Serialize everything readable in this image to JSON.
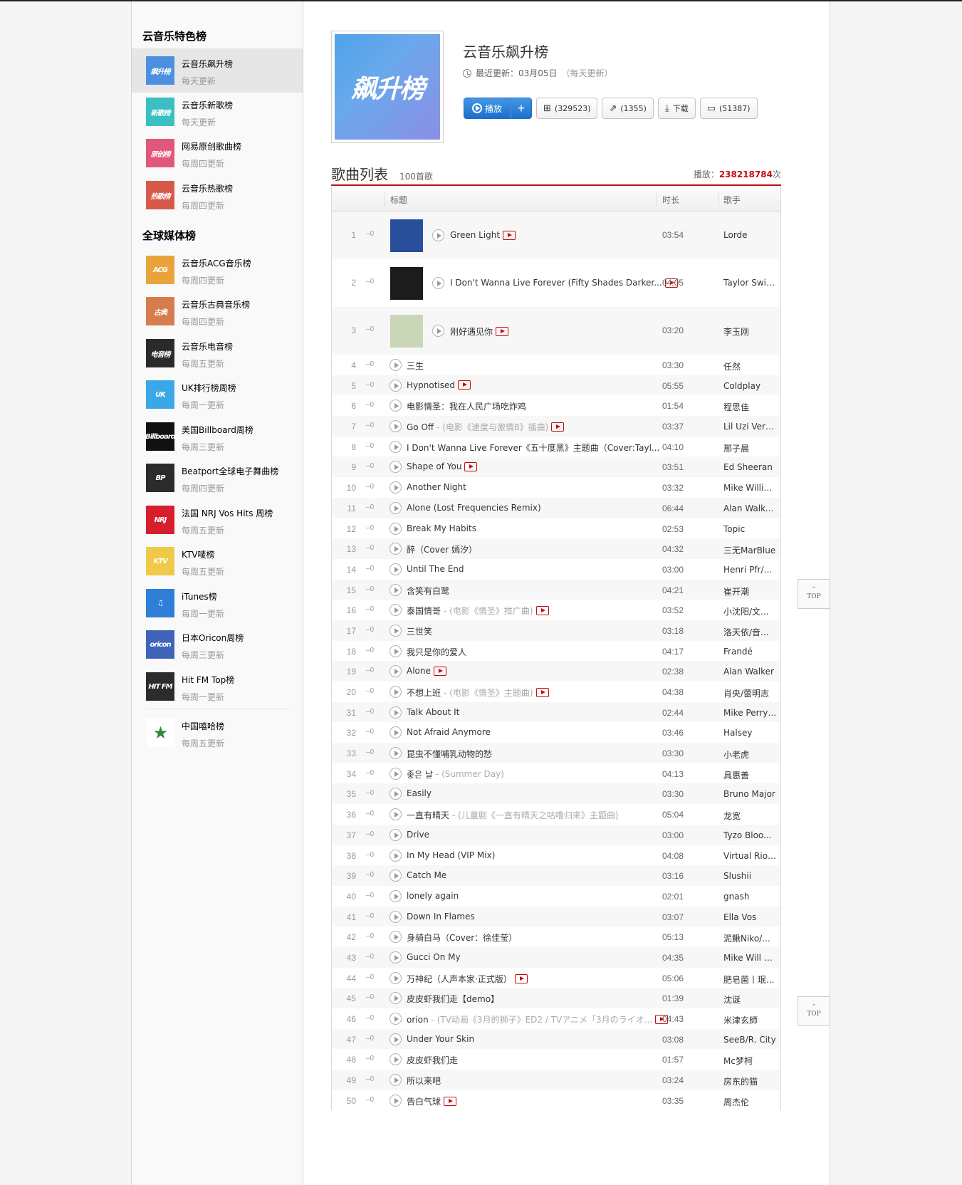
{
  "sidebar": {
    "section1_title": "云音乐特色榜",
    "section2_title": "全球媒体榜",
    "items": [
      {
        "name": "云音乐飙升榜",
        "freq": "每天更新",
        "cover_text": "飙升榜",
        "color": "#4d8fe0"
      },
      {
        "name": "云音乐新歌榜",
        "freq": "每天更新",
        "cover_text": "新歌榜",
        "color": "#3bbfc3"
      },
      {
        "name": "网易原创歌曲榜",
        "freq": "每周四更新",
        "cover_text": "原创榜",
        "color": "#e0577a"
      },
      {
        "name": "云音乐热歌榜",
        "freq": "每周四更新",
        "cover_text": "热歌榜",
        "color": "#d65a4a"
      },
      {
        "name": "云音乐ACG音乐榜",
        "freq": "每周四更新",
        "cover_text": "ACG",
        "color": "#e9a33b"
      },
      {
        "name": "云音乐古典音乐榜",
        "freq": "每周四更新",
        "cover_text": "古典",
        "color": "#d77c4d"
      },
      {
        "name": "云音乐电音榜",
        "freq": "每周五更新",
        "cover_text": "电音榜",
        "color": "#2a2a2a"
      },
      {
        "name": "UK排行榜周榜",
        "freq": "每周一更新",
        "cover_text": "UK",
        "color": "#3aa8e8"
      },
      {
        "name": "美国Billboard周榜",
        "freq": "每周三更新",
        "cover_text": "Billboard",
        "color": "#111111"
      },
      {
        "name": "Beatport全球电子舞曲榜",
        "freq": "每周四更新",
        "cover_text": "BP",
        "color": "#2b2b2b"
      },
      {
        "name": "法国 NRJ Vos Hits 周榜",
        "freq": "每周五更新",
        "cover_text": "NRJ",
        "color": "#d61f2b"
      },
      {
        "name": "KTV唛榜",
        "freq": "每周五更新",
        "cover_text": "KTV",
        "color": "#f0c948"
      },
      {
        "name": "iTunes榜",
        "freq": "每周一更新",
        "cover_text": "♫",
        "color": "#2f7fd8"
      },
      {
        "name": "日本Oricon周榜",
        "freq": "每周三更新",
        "cover_text": "oricon",
        "color": "#3f63b8"
      },
      {
        "name": "Hit FM Top榜",
        "freq": "每周一更新",
        "cover_text": "HIT FM",
        "color": "#2c2c2c"
      },
      {
        "name": "中国嘻哈榜",
        "freq": "每周五更新",
        "cover_text": "★",
        "color": "#ffffff"
      }
    ]
  },
  "header": {
    "cover_text": "飙升榜",
    "title": "云音乐飙升榜",
    "update_label": "最近更新：03月05日",
    "update_note": "（每天更新）",
    "play_label": "播放",
    "add_label": "+",
    "collect_count": "(329523)",
    "share_count": "(1355)",
    "download_label": "下载",
    "comment_count": "(51387)"
  },
  "list": {
    "title": "歌曲列表",
    "count": "100首歌",
    "plays_label": "播放：",
    "plays_value": "238218784",
    "plays_unit": "次",
    "columns": {
      "title": "标题",
      "duration": "时长",
      "artist": "歌手"
    }
  },
  "songs": [
    {
      "rank": "1",
      "trend": "–0",
      "title": "Green Light",
      "sub": "",
      "mv": true,
      "duration": "03:54",
      "artist": "Lorde",
      "thumb": "#2a4f9a"
    },
    {
      "rank": "2",
      "trend": "–0",
      "title": "I Don't Wanna Live Forever (Fifty Shades Darker...",
      "sub": "",
      "mv": true,
      "duration": "04:05",
      "artist": "Taylor Swift...",
      "thumb": "#1c1c1c"
    },
    {
      "rank": "3",
      "trend": "–0",
      "title": "刚好遇见你",
      "sub": "",
      "mv": true,
      "duration": "03:20",
      "artist": "李玉刚",
      "thumb": "#c9d6b8"
    },
    {
      "rank": "4",
      "trend": "–0",
      "title": "三生",
      "sub": "",
      "mv": false,
      "duration": "03:30",
      "artist": "任然"
    },
    {
      "rank": "5",
      "trend": "–0",
      "title": "Hypnotised",
      "sub": "",
      "mv": true,
      "duration": "05:55",
      "artist": "Coldplay"
    },
    {
      "rank": "6",
      "trend": "–0",
      "title": "电影情圣：我在人民广场吃炸鸡",
      "sub": "",
      "mv": false,
      "duration": "01:54",
      "artist": "程思佳"
    },
    {
      "rank": "7",
      "trend": "–0",
      "title": "Go Off",
      "sub": " - (电影《速度与激情8》插曲)",
      "mv": true,
      "duration": "03:37",
      "artist": "Lil Uzi Vert/..."
    },
    {
      "rank": "8",
      "trend": "–0",
      "title": "I Don't Wanna Live Forever《五十度黑》主题曲（Cover:Tayl...",
      "sub": "",
      "mv": false,
      "duration": "04:10",
      "artist": "邢子晨"
    },
    {
      "rank": "9",
      "trend": "–0",
      "title": "Shape of You",
      "sub": "",
      "mv": true,
      "duration": "03:51",
      "artist": "Ed Sheeran"
    },
    {
      "rank": "10",
      "trend": "–0",
      "title": "Another Night",
      "sub": "",
      "mv": false,
      "duration": "03:32",
      "artist": "Mike Willia..."
    },
    {
      "rank": "11",
      "trend": "–0",
      "title": "Alone (Lost Frequencies Remix)",
      "sub": "",
      "mv": false,
      "duration": "06:44",
      "artist": "Alan Walke..."
    },
    {
      "rank": "12",
      "trend": "–0",
      "title": "Break My Habits",
      "sub": "",
      "mv": false,
      "duration": "02:53",
      "artist": "Topic"
    },
    {
      "rank": "13",
      "trend": "–0",
      "title": "醉（Cover 嫣汐）",
      "sub": "",
      "mv": false,
      "duration": "04:32",
      "artist": "三无MarBlue"
    },
    {
      "rank": "14",
      "trend": "–0",
      "title": "Until The End",
      "sub": "",
      "mv": false,
      "duration": "03:00",
      "artist": "Henri Pfr/R..."
    },
    {
      "rank": "15",
      "trend": "–0",
      "title": "含笑有白鹭",
      "sub": "",
      "mv": false,
      "duration": "04:21",
      "artist": "崔开潮"
    },
    {
      "rank": "16",
      "trend": "–0",
      "title": "泰国情哥",
      "sub": " - (电影《情圣》推广曲)",
      "mv": true,
      "duration": "03:52",
      "artist": "小沈阳/文..."
    },
    {
      "rank": "17",
      "trend": "–0",
      "title": "三世笑",
      "sub": "",
      "mv": false,
      "duration": "03:18",
      "artist": "洛天依/音..."
    },
    {
      "rank": "18",
      "trend": "–0",
      "title": "我只是你的爱人",
      "sub": "",
      "mv": false,
      "duration": "04:17",
      "artist": "Frandé"
    },
    {
      "rank": "19",
      "trend": "–0",
      "title": "Alone",
      "sub": "",
      "mv": true,
      "duration": "02:38",
      "artist": "Alan Walker"
    },
    {
      "rank": "20",
      "trend": "–0",
      "title": "不想上班",
      "sub": " - (电影《情圣》主题曲)",
      "mv": true,
      "duration": "04:38",
      "artist": "肖央/蕾明志"
    },
    {
      "rank": "31",
      "trend": "–0",
      "title": "Talk About It",
      "sub": "",
      "mv": false,
      "duration": "02:44",
      "artist": "Mike Perry/..."
    },
    {
      "rank": "32",
      "trend": "–0",
      "title": "Not Afraid Anymore",
      "sub": "",
      "mv": false,
      "duration": "03:46",
      "artist": "Halsey"
    },
    {
      "rank": "33",
      "trend": "–0",
      "title": "昆虫不懂哺乳动物的愁",
      "sub": "",
      "mv": false,
      "duration": "03:30",
      "artist": "小老虎"
    },
    {
      "rank": "34",
      "trend": "–0",
      "title": "좋은 날",
      "sub": " - (Summer Day)",
      "mv": false,
      "duration": "04:13",
      "artist": "具惠善"
    },
    {
      "rank": "35",
      "trend": "–0",
      "title": "Easily",
      "sub": "",
      "mv": false,
      "duration": "03:30",
      "artist": "Bruno Major"
    },
    {
      "rank": "36",
      "trend": "–0",
      "title": "一直有晴天",
      "sub": " - (儿童剧《一直有晴天之咕噜归来》主题曲)",
      "mv": false,
      "duration": "05:04",
      "artist": "龙宽"
    },
    {
      "rank": "37",
      "trend": "–0",
      "title": "Drive",
      "sub": "",
      "mv": false,
      "duration": "03:00",
      "artist": "Tyzo Bloo..."
    },
    {
      "rank": "38",
      "trend": "–0",
      "title": "In My Head (VIP Mix)",
      "sub": "",
      "mv": false,
      "duration": "04:08",
      "artist": "Virtual Riot..."
    },
    {
      "rank": "39",
      "trend": "–0",
      "title": "Catch Me",
      "sub": "",
      "mv": false,
      "duration": "03:16",
      "artist": "Slushii"
    },
    {
      "rank": "40",
      "trend": "–0",
      "title": "lonely again",
      "sub": "",
      "mv": false,
      "duration": "02:01",
      "artist": "gnash"
    },
    {
      "rank": "41",
      "trend": "–0",
      "title": "Down In Flames",
      "sub": "",
      "mv": false,
      "duration": "03:07",
      "artist": "Ella Vos"
    },
    {
      "rank": "42",
      "trend": "–0",
      "title": "身骑白马（Cover：徐佳莹）",
      "sub": "",
      "mv": false,
      "duration": "05:13",
      "artist": "泥鳅Niko/..."
    },
    {
      "rank": "43",
      "trend": "–0",
      "title": "Gucci On My",
      "sub": "",
      "mv": false,
      "duration": "04:35",
      "artist": "Mike Will M..."
    },
    {
      "rank": "44",
      "trend": "–0",
      "title": "万神纪（人声本家·正式版）",
      "sub": "",
      "mv": true,
      "duration": "05:06",
      "artist": "肥皂菌丨珉..."
    },
    {
      "rank": "45",
      "trend": "–0",
      "title": "皮皮虾我们走【demo】",
      "sub": "",
      "mv": false,
      "duration": "01:39",
      "artist": "沈诞"
    },
    {
      "rank": "46",
      "trend": "–0",
      "title": "orion",
      "sub": " - (TV动画《3月的狮子》ED2 / TVアニメ「3月のライオ...",
      "mv": true,
      "duration": "04:43",
      "artist": "米津玄師"
    },
    {
      "rank": "47",
      "trend": "–0",
      "title": "Under Your Skin",
      "sub": "",
      "mv": false,
      "duration": "03:08",
      "artist": "SeeB/R. City"
    },
    {
      "rank": "48",
      "trend": "–0",
      "title": "皮皮虾我们走",
      "sub": "",
      "mv": false,
      "duration": "01:57",
      "artist": "Mc梦柯"
    },
    {
      "rank": "49",
      "trend": "–0",
      "title": "所以来吧",
      "sub": "",
      "mv": false,
      "duration": "03:24",
      "artist": "房东的猫"
    },
    {
      "rank": "50",
      "trend": "–0",
      "title": "告白气球",
      "sub": "",
      "mv": true,
      "duration": "03:35",
      "artist": "周杰伦"
    }
  ],
  "top_button_label": "TOP"
}
